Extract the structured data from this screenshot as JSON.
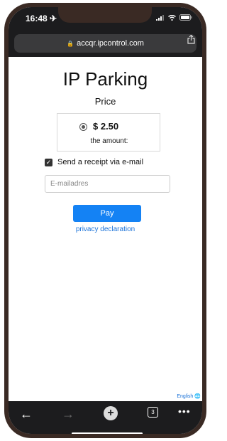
{
  "status_bar": {
    "time": "16:48 ✈"
  },
  "browser": {
    "url": "accqr.ipcontrol.com"
  },
  "page": {
    "title": "IP Parking",
    "subtitle": "Price",
    "price": {
      "amount": "$ 2.50",
      "caption": "the amount:"
    },
    "receipt": {
      "label": "Send a receipt via e-mail",
      "checked": true
    },
    "email": {
      "placeholder": "E-mailadres",
      "value": ""
    },
    "pay_label": "Pay",
    "privacy_label": "privacy declaration",
    "language_label": "English"
  },
  "toolbar": {
    "tab_count": "3"
  },
  "colors": {
    "accent": "#1482f4",
    "link": "#1a72d8",
    "chrome": "#1c1c1e"
  }
}
